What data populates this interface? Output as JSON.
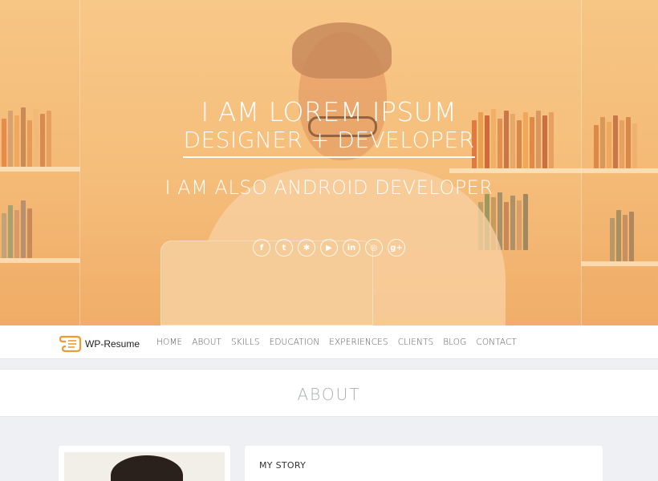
{
  "hero": {
    "title_line1": "I AM LOREM IPSUM",
    "title_line2": "DESIGNER + DEVELOPER",
    "title_line3": "I AM ALSO ANDROID DEVELOPER",
    "overlay_color": "#f6c27e",
    "social": [
      {
        "name": "facebook-icon",
        "glyph": "f"
      },
      {
        "name": "twitter-icon",
        "glyph": "t"
      },
      {
        "name": "dribbble-icon",
        "glyph": "✱"
      },
      {
        "name": "youtube-icon",
        "glyph": "▶"
      },
      {
        "name": "linkedin-icon",
        "glyph": "in"
      },
      {
        "name": "github-icon",
        "glyph": "◎"
      },
      {
        "name": "google-plus-icon",
        "glyph": "g+"
      }
    ]
  },
  "nav": {
    "logo_text": "WP-Resume",
    "items": [
      "HOME",
      "ABOUT",
      "SKILLS",
      "EDUCATION",
      "EXPERIENCES",
      "CLIENTS",
      "BLOG",
      "CONTACT"
    ]
  },
  "about": {
    "heading": "ABOUT",
    "story_title": "MY STORY"
  }
}
